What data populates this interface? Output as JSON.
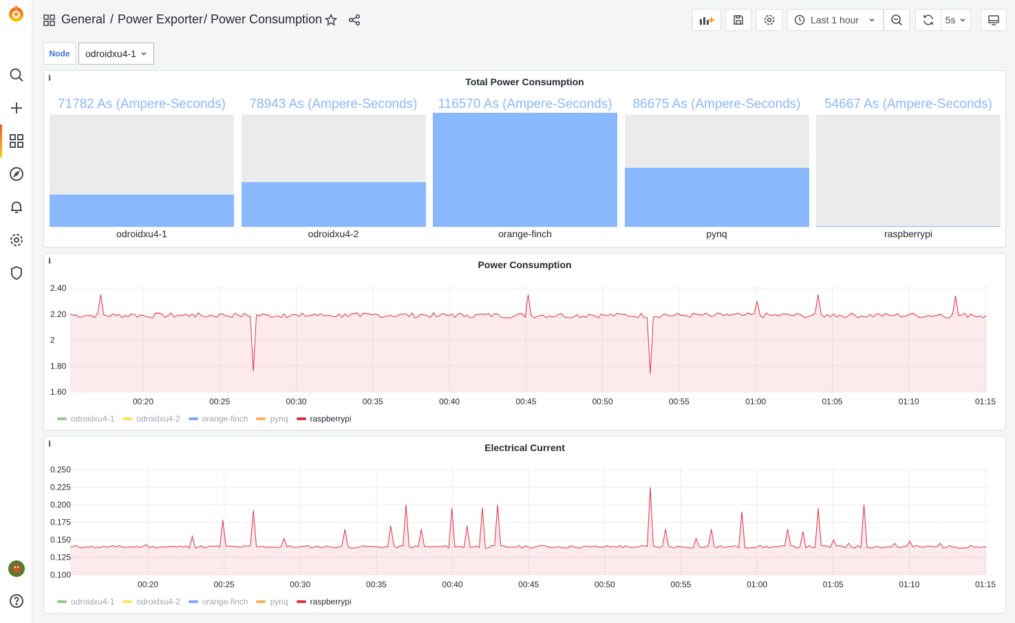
{
  "nav": {
    "items": [
      {
        "icon": "grafana-logo-icon"
      },
      {
        "icon": "search-icon"
      },
      {
        "icon": "plus-icon"
      },
      {
        "icon": "dashboards-icon"
      },
      {
        "icon": "explore-compass-icon"
      },
      {
        "icon": "alerting-bell-icon"
      },
      {
        "icon": "gear-icon"
      },
      {
        "icon": "shield-icon"
      },
      {
        "icon": "avatar"
      },
      {
        "icon": "help-icon"
      }
    ]
  },
  "header": {
    "folder": "General",
    "sep1": "/",
    "dashboard_parent": "Power Exporter",
    "sep2": "/",
    "dashboard": "Power Consumption",
    "time_range": "Last 1 hour",
    "refresh": "5s"
  },
  "variables": {
    "label": "Node",
    "value": "odroidxu4-1"
  },
  "panels": {
    "bargauge": {
      "title": "Total Power Consumption",
      "info": "i",
      "items": [
        {
          "name": "odroidxu4-1",
          "display": "71782 As (Ampere-Seconds)",
          "value": 71782,
          "fill": 0.29
        },
        {
          "name": "odroidxu4-2",
          "display": "78943 As (Ampere-Seconds)",
          "value": 78943,
          "fill": 0.4
        },
        {
          "name": "orange-finch",
          "display": "116570 As (Ampere-Seconds)",
          "value": 116570,
          "fill": 1.0
        },
        {
          "name": "pynq",
          "display": "86675 As (Ampere-Seconds)",
          "value": 86675,
          "fill": 0.53
        },
        {
          "name": "raspberrypi",
          "display": "54667 As (Ampere-Seconds)",
          "value": 54667,
          "fill": 0.008
        }
      ]
    },
    "power": {
      "title": "Power Consumption",
      "info": "i"
    },
    "current": {
      "title": "Electrical Current",
      "info": "i"
    },
    "legend": [
      {
        "name": "odroidxu4-1",
        "color": "#73bf69",
        "active": false
      },
      {
        "name": "odroidxu4-2",
        "color": "#fade2a",
        "active": false
      },
      {
        "name": "orange-finch",
        "color": "#5794f2",
        "active": false
      },
      {
        "name": "pynq",
        "color": "#ff9830",
        "active": false
      },
      {
        "name": "raspberrypi",
        "color": "#e02f44",
        "active": true
      }
    ]
  },
  "chart_data": [
    {
      "type": "area",
      "title": "Power Consumption",
      "series": [
        {
          "name": "raspberrypi",
          "color": "#e02f44",
          "x": [
            "00:15",
            "00:16",
            "00:17",
            "00:18",
            "00:19",
            "00:20",
            "00:21",
            "00:22",
            "00:23",
            "00:24",
            "00:25",
            "00:26",
            "00:27",
            "00:28",
            "00:29",
            "00:30",
            "00:31",
            "00:32",
            "00:33",
            "00:34",
            "00:35",
            "00:36",
            "00:37",
            "00:38",
            "00:39",
            "00:40",
            "00:41",
            "00:42",
            "00:43",
            "00:44",
            "00:45",
            "00:46",
            "00:47",
            "00:48",
            "00:49",
            "00:50",
            "00:51",
            "00:52",
            "00:53",
            "00:54",
            "00:55",
            "00:56",
            "00:57",
            "00:58",
            "00:59",
            "01:00",
            "01:01",
            "01:02",
            "01:03",
            "01:04",
            "01:05",
            "01:06",
            "01:07",
            "01:08",
            "01:09",
            "01:10",
            "01:11",
            "01:12",
            "01:13",
            "01:14",
            "01:15"
          ],
          "values": [
            2.2,
            2.19,
            2.35,
            2.19,
            2.2,
            2.18,
            2.2,
            2.19,
            2.2,
            2.18,
            2.2,
            2.19,
            1.76,
            2.19,
            2.2,
            2.18,
            2.2,
            2.19,
            2.2,
            2.18,
            2.2,
            2.19,
            2.2,
            2.2,
            2.18,
            2.2,
            2.19,
            2.2,
            2.2,
            2.18,
            2.35,
            2.19,
            2.2,
            2.18,
            2.2,
            2.19,
            2.2,
            2.18,
            1.74,
            2.2,
            2.19,
            2.2,
            2.18,
            2.2,
            2.19,
            2.3,
            2.19,
            2.2,
            2.18,
            2.35,
            2.2,
            2.19,
            2.18,
            2.2,
            2.19,
            2.2,
            2.18,
            2.2,
            2.34,
            2.2,
            2.19
          ]
        }
      ],
      "y_ticks": [
        "2.40",
        "2.20",
        "2",
        "1.80",
        "1.60"
      ],
      "x_ticks": [
        "00:20",
        "00:25",
        "00:30",
        "00:35",
        "00:40",
        "00:45",
        "00:50",
        "00:55",
        "01:00",
        "01:05",
        "01:10",
        "01:15"
      ],
      "ylim": [
        1.6,
        2.4
      ]
    },
    {
      "type": "area",
      "title": "Electrical Current",
      "series": [
        {
          "name": "raspberrypi",
          "color": "#e02f44",
          "x": [
            "00:15",
            "00:16",
            "00:17",
            "00:18",
            "00:19",
            "00:20",
            "00:21",
            "00:22",
            "00:23",
            "00:24",
            "00:25",
            "00:26",
            "00:27",
            "00:28",
            "00:29",
            "00:30",
            "00:31",
            "00:32",
            "00:33",
            "00:34",
            "00:35",
            "00:36",
            "00:37",
            "00:38",
            "00:39",
            "00:40",
            "00:41",
            "00:42",
            "00:43",
            "00:44",
            "00:45",
            "00:46",
            "00:47",
            "00:48",
            "00:49",
            "00:50",
            "00:51",
            "00:52",
            "00:53",
            "00:54",
            "00:55",
            "00:56",
            "00:57",
            "00:58",
            "00:59",
            "01:00",
            "01:01",
            "01:02",
            "01:03",
            "01:04",
            "01:05",
            "01:06",
            "01:07",
            "01:08",
            "01:09",
            "01:10",
            "01:11",
            "01:12",
            "01:13",
            "01:14",
            "01:15"
          ],
          "values": [
            0.14,
            0.14,
            0.139,
            0.14,
            0.14,
            0.143,
            0.14,
            0.14,
            0.155,
            0.14,
            0.178,
            0.14,
            0.192,
            0.14,
            0.152,
            0.14,
            0.14,
            0.14,
            0.165,
            0.14,
            0.14,
            0.17,
            0.2,
            0.165,
            0.14,
            0.195,
            0.17,
            0.196,
            0.2,
            0.14,
            0.14,
            0.142,
            0.14,
            0.14,
            0.14,
            0.14,
            0.142,
            0.14,
            0.225,
            0.165,
            0.14,
            0.152,
            0.165,
            0.14,
            0.19,
            0.14,
            0.14,
            0.165,
            0.162,
            0.195,
            0.15,
            0.145,
            0.2,
            0.14,
            0.145,
            0.148,
            0.14,
            0.145,
            0.14,
            0.142,
            0.14
          ]
        }
      ],
      "y_ticks": [
        "0.250",
        "0.225",
        "0.200",
        "0.175",
        "0.150",
        "0.125",
        "0.100"
      ],
      "x_ticks": [
        "00:20",
        "00:25",
        "00:30",
        "00:35",
        "00:40",
        "00:45",
        "00:50",
        "00:55",
        "01:00",
        "01:05",
        "01:10",
        "01:15"
      ],
      "ylim": [
        0.1,
        0.25
      ]
    }
  ]
}
